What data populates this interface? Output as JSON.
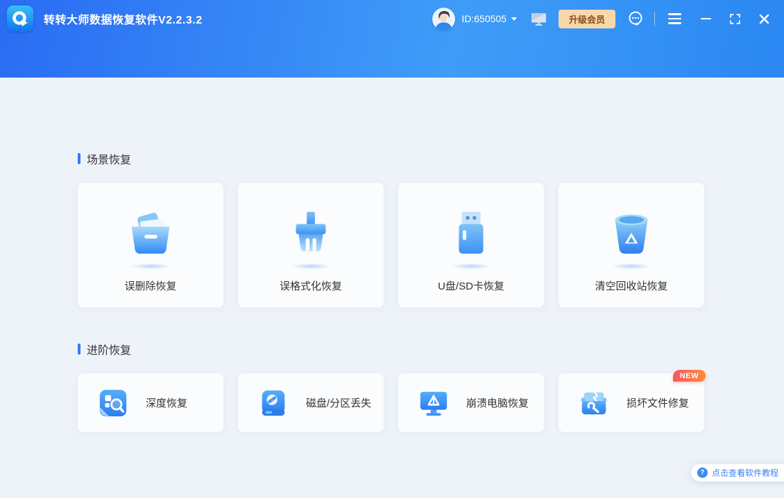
{
  "app": {
    "title": "转转大师数据恢复软件V2.2.3.2",
    "logo_icon": "magnifier-arrow-logo"
  },
  "titlebar": {
    "user_id": "ID:650505",
    "upgrade_button": "升级会员",
    "icons": {
      "avatar": "user-avatar",
      "dropdown": "chevron-down-icon",
      "monitor": "device-monitor-icon",
      "service": "customer-service-icon",
      "menu": "hamburger-menu-icon",
      "minimize": "minimize-icon",
      "maximize": "maximize-icon",
      "close": "close-icon"
    }
  },
  "sections": [
    {
      "title": "场景恢复",
      "cards": [
        {
          "label": "误删除恢复",
          "icon": "folder-icon"
        },
        {
          "label": "误格式化恢复",
          "icon": "format-brush-icon"
        },
        {
          "label": "U盘/SD卡恢复",
          "icon": "usb-drive-icon"
        },
        {
          "label": "清空回收站恢复",
          "icon": "recycle-bin-icon"
        }
      ]
    },
    {
      "title": "进阶恢复",
      "cards": [
        {
          "label": "深度恢复",
          "icon": "deep-scan-icon"
        },
        {
          "label": "磁盘/分区丢失",
          "icon": "disk-partition-icon"
        },
        {
          "label": "崩溃电脑恢复",
          "icon": "crashed-pc-icon"
        },
        {
          "label": "损坏文件修复",
          "icon": "file-repair-icon",
          "badge": "NEW"
        }
      ]
    }
  ],
  "footer": {
    "help_icon": "question-circle-icon",
    "help_text": "点击查看软件教程",
    "help_icon_glyph": "?"
  },
  "colors": {
    "header_gradient_left": "#2a6cf3",
    "header_gradient_mid": "#3f9df8",
    "header_gradient_right": "#2b87f2",
    "page_background": "#eef2f9",
    "card_background": "#fafcfe",
    "accent_blue": "#2f7ef5",
    "upgrade_bg": "#f6d8a9",
    "upgrade_text": "#8a4d1a",
    "badge_gradient_start": "#f8565f",
    "badge_gradient_end": "#fb8e3a",
    "help_text_color": "#3b82f0",
    "label_text": "#333333"
  }
}
